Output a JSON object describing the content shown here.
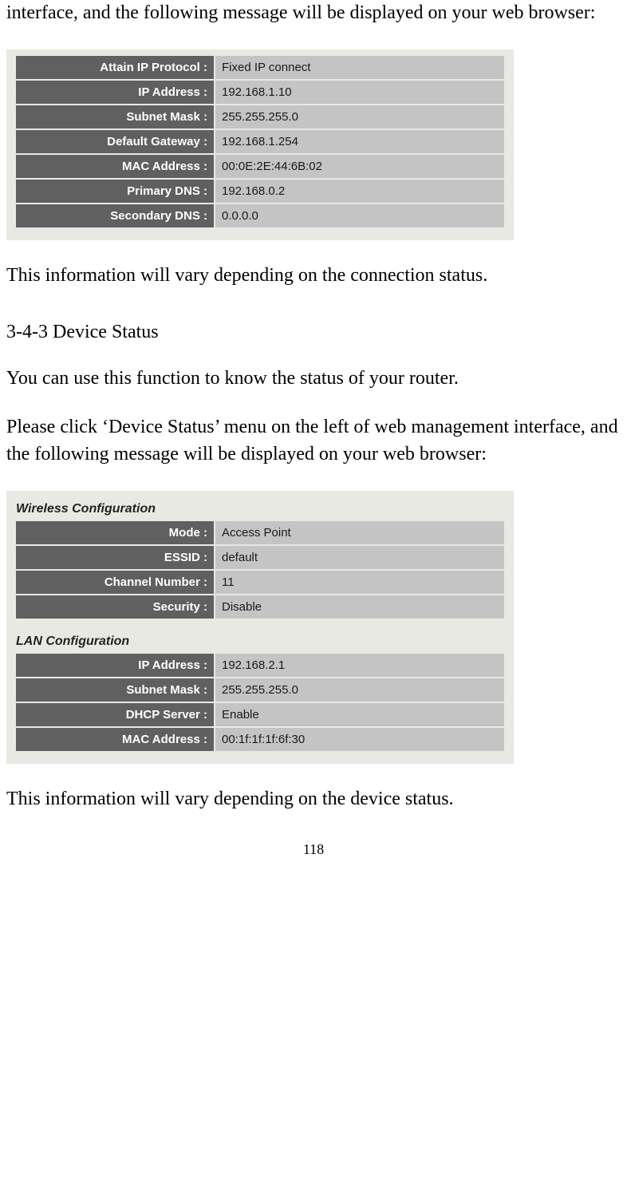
{
  "intro_fragment": "interface, and the following message will be displayed on your web browser:",
  "table1": {
    "rows": [
      {
        "label": "Attain IP Protocol :",
        "value": "Fixed IP connect"
      },
      {
        "label": "IP Address :",
        "value": "192.168.1.10"
      },
      {
        "label": "Subnet Mask :",
        "value": "255.255.255.0"
      },
      {
        "label": "Default Gateway :",
        "value": "192.168.1.254"
      },
      {
        "label": "MAC Address :",
        "value": "00:0E:2E:44:6B:02"
      },
      {
        "label": "Primary DNS :",
        "value": "192.168.0.2"
      },
      {
        "label": "Secondary DNS :",
        "value": "0.0.0.0"
      }
    ]
  },
  "after_table1": "This information will vary depending on the connection status.",
  "section_heading": "3-4-3 Device Status",
  "para_a": "You can use this function to know the status of your router.",
  "para_b": "Please click ‘Device Status’ menu on the left of web management interface, and the following message will be displayed on your web browser:",
  "table2": {
    "wireless_title": "Wireless Configuration",
    "wireless_rows": [
      {
        "label": "Mode :",
        "value": "Access Point"
      },
      {
        "label": "ESSID :",
        "value": "default"
      },
      {
        "label": "Channel Number :",
        "value": "11"
      },
      {
        "label": "Security :",
        "value": "Disable"
      }
    ],
    "lan_title": "LAN Configuration",
    "lan_rows": [
      {
        "label": "IP Address :",
        "value": "192.168.2.1"
      },
      {
        "label": "Subnet Mask :",
        "value": "255.255.255.0"
      },
      {
        "label": "DHCP Server :",
        "value": "Enable"
      },
      {
        "label": "MAC Address :",
        "value": "00:1f:1f:1f:6f:30"
      }
    ]
  },
  "after_table2": "This information will vary depending on the device status.",
  "page_number": "118"
}
